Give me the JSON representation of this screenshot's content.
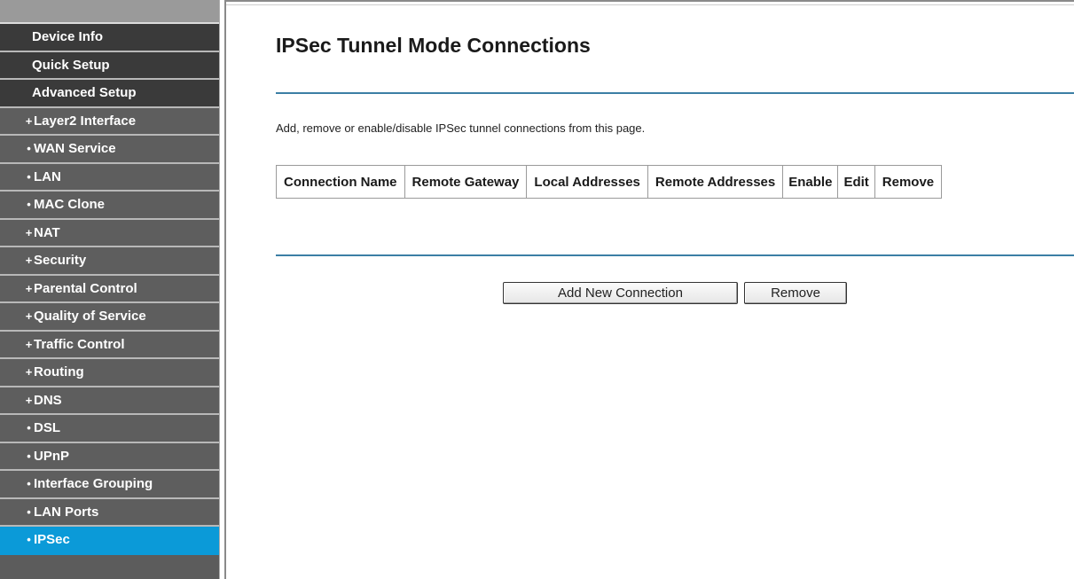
{
  "sidebar": {
    "items": [
      {
        "label": "Device Info",
        "level": "top",
        "bullet": ""
      },
      {
        "label": "Quick Setup",
        "level": "top",
        "bullet": ""
      },
      {
        "label": "Advanced Setup",
        "level": "top",
        "bullet": ""
      },
      {
        "label": "Layer2 Interface",
        "level": "sub",
        "bullet": "+"
      },
      {
        "label": "WAN Service",
        "level": "sub",
        "bullet": "•"
      },
      {
        "label": "LAN",
        "level": "sub",
        "bullet": "•"
      },
      {
        "label": "MAC Clone",
        "level": "sub",
        "bullet": "•"
      },
      {
        "label": "NAT",
        "level": "sub",
        "bullet": "+"
      },
      {
        "label": "Security",
        "level": "sub",
        "bullet": "+"
      },
      {
        "label": "Parental Control",
        "level": "sub",
        "bullet": "+"
      },
      {
        "label": "Quality of Service",
        "level": "sub",
        "bullet": "+"
      },
      {
        "label": "Traffic Control",
        "level": "sub",
        "bullet": "+"
      },
      {
        "label": "Routing",
        "level": "sub",
        "bullet": "+"
      },
      {
        "label": "DNS",
        "level": "sub",
        "bullet": "+"
      },
      {
        "label": "DSL",
        "level": "sub",
        "bullet": "•"
      },
      {
        "label": "UPnP",
        "level": "sub",
        "bullet": "•"
      },
      {
        "label": "Interface Grouping",
        "level": "sub",
        "bullet": "•"
      },
      {
        "label": "LAN Ports",
        "level": "sub",
        "bullet": "•"
      },
      {
        "label": "IPSec",
        "level": "sub",
        "bullet": "•",
        "active": true
      }
    ]
  },
  "main": {
    "title": "IPSec Tunnel Mode Connections",
    "description": "Add, remove or enable/disable IPSec tunnel connections from this page.",
    "table": {
      "headers": [
        "Connection Name",
        "Remote Gateway",
        "Local Addresses",
        "Remote Addresses",
        "Enable",
        "Edit",
        "Remove"
      ],
      "rows": []
    },
    "buttons": {
      "add": "Add New Connection",
      "remove": "Remove"
    }
  },
  "colors": {
    "active_nav": "#0b9ad8",
    "top_nav": "#3a3a3a",
    "sub_nav": "#5e5e5e",
    "rule": "#3b7fa5"
  }
}
